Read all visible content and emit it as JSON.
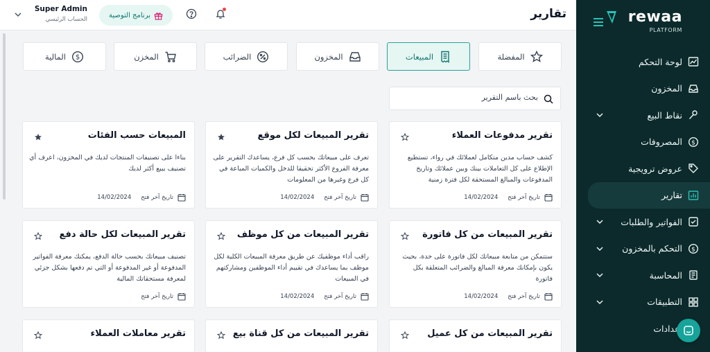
{
  "brand": {
    "name": "rewaa",
    "sub": "PLATFORM"
  },
  "sidebar": {
    "items": [
      {
        "label": "لوحة التحكم",
        "icon": "chart-line-icon",
        "chevron": false,
        "active": false
      },
      {
        "label": "المخزون",
        "icon": "inbox-icon",
        "chevron": false,
        "active": false
      },
      {
        "label": "نقاط البيع",
        "icon": "pos-icon",
        "chevron": true,
        "active": false
      },
      {
        "label": "المصروفات",
        "icon": "dollar-circle-icon",
        "chevron": false,
        "active": false
      },
      {
        "label": "عروض ترويجية",
        "icon": "tag-icon",
        "chevron": false,
        "active": false
      },
      {
        "label": "تقارير",
        "icon": "report-chart-icon",
        "chevron": false,
        "active": true
      },
      {
        "label": "الفواتير والطلبات",
        "icon": "checkbox-icon",
        "chevron": true,
        "active": false
      },
      {
        "label": "التحكم بالمخزون",
        "icon": "dollar-circle-icon",
        "chevron": true,
        "active": false
      },
      {
        "label": "المحاسبة",
        "icon": "book-icon",
        "chevron": true,
        "active": false
      },
      {
        "label": "التطبيقات",
        "icon": "grid-icon",
        "chevron": true,
        "active": false
      },
      {
        "label": "إعدادات",
        "icon": "gear-icon",
        "chevron": false,
        "active": false
      }
    ]
  },
  "header": {
    "title": "تقارير",
    "user_name": "Super Admin",
    "user_role": "الحساب الرئيسي",
    "referral_label": "برنامج التوصية"
  },
  "categories": [
    {
      "label": "المفضلة",
      "icon": "star-icon",
      "active": false
    },
    {
      "label": "المبيعات",
      "icon": "receipt-icon",
      "active": true
    },
    {
      "label": "المخزون",
      "icon": "inbox-icon",
      "active": false
    },
    {
      "label": "الضرائب",
      "icon": "percent-icon",
      "active": false
    },
    {
      "label": "المخزن",
      "icon": "cart-icon",
      "active": false
    },
    {
      "label": "المالية",
      "icon": "dollar-circle-icon",
      "active": false
    }
  ],
  "search": {
    "placeholder": "بحث باسم التقرير"
  },
  "footer_label": "تاريخ آخر فتح",
  "cards": [
    {
      "title": "تقرير مدفوعات العملاء",
      "favorite": false,
      "desc": "كشف حساب مدين متكامل لعملائك في رواء، تستطيع الإطلاع على كل التعاملات بينك وبين عملائك وتاريخ المدفوعات والمبالغ المستحقة لكل فترة زمنية",
      "date": "14/02/2024"
    },
    {
      "title": "تقرير المبيعات لكل موقع",
      "favorite": true,
      "desc": "تعرف على مبيعاتك بحسب كل فرع، يساعدك التقرير على معرفة الفروع الأكثر تحقيقا للدخل والكميات المباعة في كل فرع وغيرها من المعلومات",
      "date": "14/02/2024"
    },
    {
      "title": "المبيعات حسب الفئات",
      "favorite": true,
      "desc": "بناءا على تصنيفات المنتجات لديك في المخزون، اعرف أي تصنيف يبيع أكثر لديك",
      "date": "14/02/2024"
    },
    {
      "title": "تقرير المبيعات من كل فاتورة",
      "favorite": false,
      "desc": "ستتمكن من متابعة مبيعاتك لكل فاتورة على حدة، بحيث يكون بإمكانك معرفة المبالغ والضرائب المتعلقة بكل فاتورة",
      "date": "14/02/2024"
    },
    {
      "title": "تقرير المبيعات من كل موظف",
      "favorite": false,
      "desc": "راقب أداء موظفيك عن طريق معرفة المبيعات الكلية لكل موظف بما يساعدك في تقييم أداء الموظفين ومشاركتهم في المبيعات",
      "date": "14/02/2024"
    },
    {
      "title": "تقرير المبيعات لكل حالة دفع",
      "favorite": false,
      "desc": "تصنيف مبيعاتك بحسب حالة الدفع، يمكنك معرفة الفواتير المدفوعة أو غير المدفوعة أو التي تم دفعها بشكل جزئي لمعرفة مستحقاتك المالية",
      "date": ""
    },
    {
      "title": "تقرير المبيعات من كل عميل",
      "favorite": false,
      "desc": "",
      "date": ""
    },
    {
      "title": "تقرير المبيعات من كل قناة بيع",
      "favorite": false,
      "desc": "",
      "date": ""
    },
    {
      "title": "تقرير معاملات العملاء",
      "favorite": false,
      "desc": "",
      "date": ""
    }
  ]
}
